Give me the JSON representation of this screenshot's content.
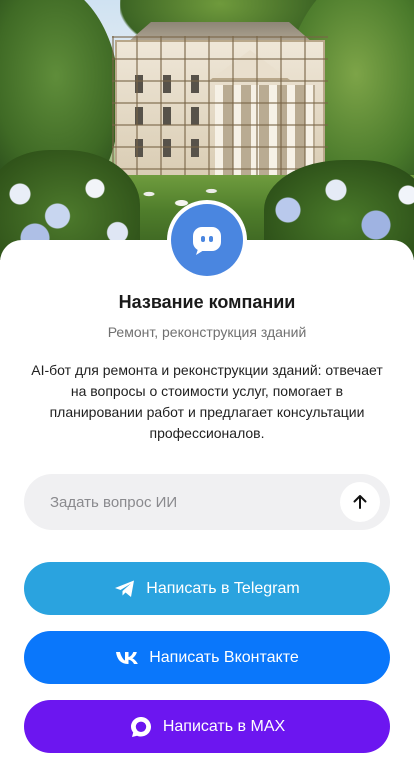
{
  "hero": {
    "image_description_icon": "building-renovation-photo"
  },
  "profile": {
    "avatar_icon": "chat-bubble-icon",
    "name": "Название компании",
    "subtitle": "Ремонт, реконструкция зданий",
    "description": "AI-бот для ремонта и реконструкции зданий: отвечает на вопросы о стоимости услуг, помогает в планировании работ и предлагает консультации профессионалов."
  },
  "ask": {
    "placeholder": "Задать вопрос ИИ",
    "value": "",
    "send_icon": "arrow-up-icon"
  },
  "buttons": {
    "telegram": {
      "label": "Написать в Telegram",
      "icon": "telegram-icon",
      "color": "#2aa3df"
    },
    "vk": {
      "label": "Написать Вконтакте",
      "icon": "vk-icon",
      "color": "#0a77fb"
    },
    "max": {
      "label": "Написать в MAX",
      "icon": "max-icon",
      "color": "#6c16f0"
    }
  },
  "colors": {
    "avatar": "#4a86e0",
    "input_bg": "#f0f0f2"
  }
}
